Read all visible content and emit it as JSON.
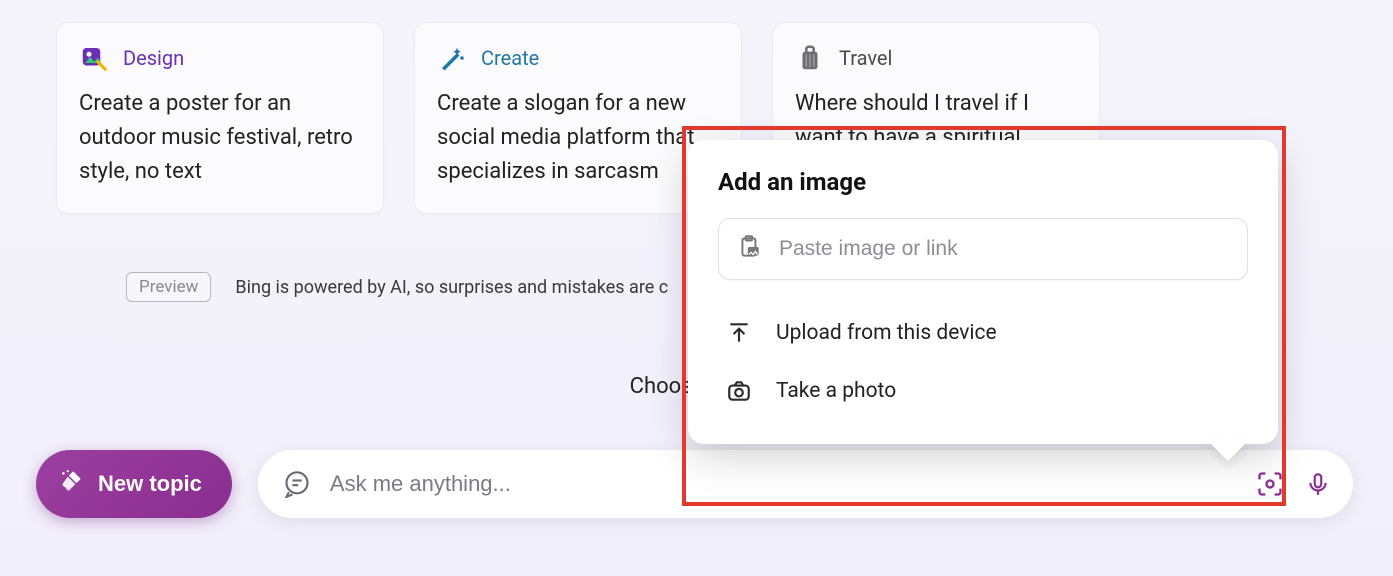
{
  "cards": [
    {
      "category": "Design",
      "text": "Create a poster for an outdoor music festival, retro style, no text"
    },
    {
      "category": "Create",
      "text": "Create a slogan for a new social media platform that specializes in sarcasm"
    },
    {
      "category": "Travel",
      "text": "Where should I travel if I want to have a spiritual experience?"
    }
  ],
  "preview_badge": "Preview",
  "disclaimer": "Bing is powered by AI, so surprises and mistakes are c",
  "choose_text": "Choose a con",
  "new_topic_label": "New topic",
  "ask_placeholder": "Ask me anything...",
  "popover": {
    "title": "Add an image",
    "paste_placeholder": "Paste image or link",
    "upload_label": "Upload from this device",
    "take_photo_label": "Take a photo"
  }
}
